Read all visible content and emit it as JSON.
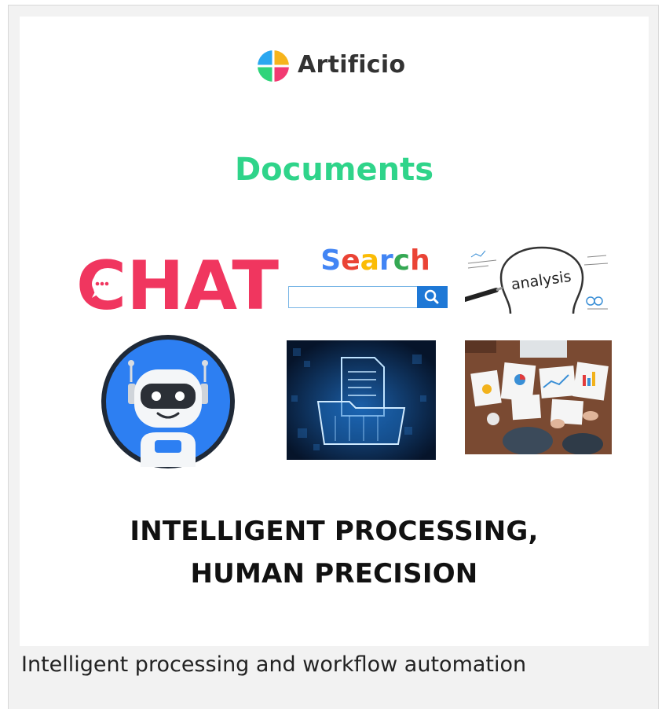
{
  "brand": {
    "name": "Artificio"
  },
  "banner": {
    "heading": "Documents",
    "chat_word": "CHAT",
    "search_word": "Search",
    "search_letter_colors": [
      "#4285f4",
      "#ea4335",
      "#fbbc05",
      "#4285f4",
      "#34a853",
      "#ea4335"
    ],
    "analysis_word": "analysis",
    "tagline_line1": "INTELLIGENT PROCESSING,",
    "tagline_line2": "HUMAN PRECISION"
  },
  "caption": "Intelligent processing and workflow automation",
  "colors": {
    "heading": "#2fd48a",
    "chat": "#f0365f",
    "search_button": "#1e78d6",
    "robot_ring": "#1f2937",
    "robot_bg": "#2d7ff2"
  }
}
